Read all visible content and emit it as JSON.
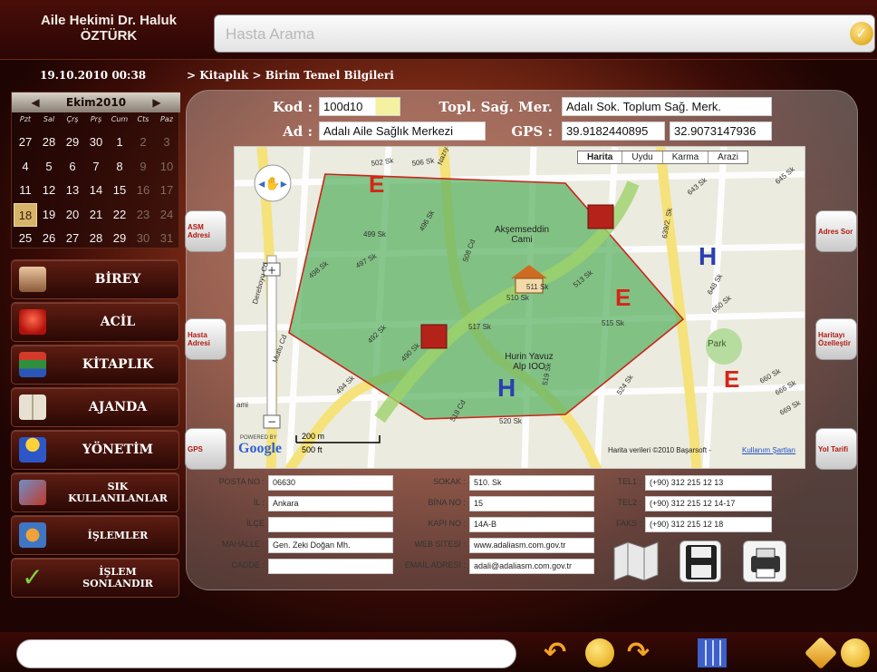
{
  "header": {
    "doctor_line1": "Aile Hekimi Dr. Haluk",
    "doctor_line2": "ÖZTÜRK",
    "search_placeholder": "Hasta Arama"
  },
  "status": {
    "datetime": "19.10.2010  00:38",
    "breadcrumb": "> Kitaplık > Birim Temel Bilgileri"
  },
  "calendar": {
    "month": "Ekim2010",
    "weekdays": [
      "Pzt",
      "Sal",
      "Çrş",
      "Prş",
      "Cum",
      "Cts",
      "Paz"
    ],
    "weeks": [
      [
        "27",
        "28",
        "29",
        "30",
        "1",
        "2",
        "3"
      ],
      [
        "4",
        "5",
        "6",
        "7",
        "8",
        "9",
        "10"
      ],
      [
        "11",
        "12",
        "13",
        "14",
        "15",
        "16",
        "17"
      ],
      [
        "18",
        "19",
        "20",
        "21",
        "22",
        "23",
        "24"
      ],
      [
        "25",
        "26",
        "27",
        "28",
        "29",
        "30",
        "31"
      ]
    ],
    "today": "18"
  },
  "nav": [
    {
      "label": "BİREY",
      "icon": "person-icon"
    },
    {
      "label": "ACİL",
      "icon": "siren-icon"
    },
    {
      "label": "KİTAPLIK",
      "icon": "books-icon"
    },
    {
      "label": "AJANDA",
      "icon": "agenda-icon"
    },
    {
      "label": "YÖNETİM",
      "icon": "users-icon"
    },
    {
      "label": "SIK KULLANILANLAR",
      "icon": "folders-icon"
    },
    {
      "label": "İŞLEMLER",
      "icon": "process-icon"
    },
    {
      "label": "İŞLEM SONLANDIR",
      "icon": "checkmark-icon"
    }
  ],
  "form": {
    "kod_label": "Kod :",
    "kod_value": "100d10",
    "topl_label": "Topl. Sağ. Mer.",
    "topl_value": "Adalı Sok. Toplum Sağ. Merk.",
    "ad_label": "Ad :",
    "ad_value": "Adalı Aile Sağlık Merkezi",
    "gps_label": "GPS :",
    "gps_lat": "39.9182440895",
    "gps_lng": "32.9073147936"
  },
  "side_buttons": {
    "asm_adresi": "ASM Adresi",
    "hasta_adresi": "Hasta Adresi",
    "gps": "GPS",
    "adres_sor": "Adres Sor",
    "haritayi_ozellestir": "Haritayı Özelleştir",
    "yol_tarifi": "Yol Tarifi"
  },
  "map": {
    "types": [
      "Harita",
      "Uydu",
      "Karma",
      "Arazi"
    ],
    "labels": {
      "mosque": "Akşemseddin Cami",
      "park": "Park",
      "hurin": "Hurin Yavuz Alp IOO",
      "scale_m": "200 m",
      "scale_ft": "500 ft",
      "attribution": "Harita verileri ©2010 Başarsoft -",
      "terms": "Kullanım Şartları",
      "powered": "POWERED BY",
      "google": "Google"
    },
    "streets": [
      "502 Sk",
      "506 Sk",
      "Nazıyolu Cd",
      "499 Sk",
      "497 Sk",
      "498 Sk",
      "496 Sk",
      "508 Cd",
      "510 Sk",
      "511 Sk",
      "513 Sk",
      "515 Sk",
      "517 Sk",
      "518 Cd",
      "490 Sk",
      "492 Sk",
      "494 Sk",
      "520 Sk",
      "519 Sk",
      "524 Sk",
      "639/2. Sk",
      "643 Sk",
      "645 Sk",
      "648 Sk",
      "650 Sk",
      "660 Sk",
      "666 Sk",
      "669 Sk",
      "Dereboyu Cd",
      "Mutlu Cd",
      "ami"
    ],
    "markers": [
      "E",
      "E",
      "E",
      "H",
      "H"
    ]
  },
  "address": {
    "posta_no_label": "POSTA NO :",
    "posta_no": "06630",
    "il_label": "İL :",
    "il": "Ankara",
    "ilce_label": "İLÇE",
    "ilce": "",
    "mahalle_label": "MAHALLE :",
    "mahalle": "Gen. Zeki Doğan Mh.",
    "cadde_label": "CADDE :",
    "cadde": "",
    "sokak_label": "SOKAK :",
    "sokak": "510. Sk",
    "bina_no_label": "BİNA NO :",
    "bina_no": "15",
    "kapi_no_label": "KAPI NO :",
    "kapi_no": "14A-B",
    "web_label": "WEB SİTESİ :",
    "web": "www.adaliasm.com.gov.tr",
    "email_label": "EMAİL ADRESİ :",
    "email": "adali@adaliasm.com.gov.tr",
    "tel1_label": "TEL1 :",
    "tel1": "(+90) 312 215 12 13",
    "tel2_label": "TEL2 :",
    "tel2": "(+90) 312 215 12 14-17",
    "faks_label": "FAKS :",
    "faks": "(+90) 312 215 12 18"
  },
  "colors": {
    "accent_red": "#c8261b",
    "area_green": "#5fb365",
    "panel_bg": "#7c2b16",
    "hospital_blue": "#2a3fb0"
  }
}
